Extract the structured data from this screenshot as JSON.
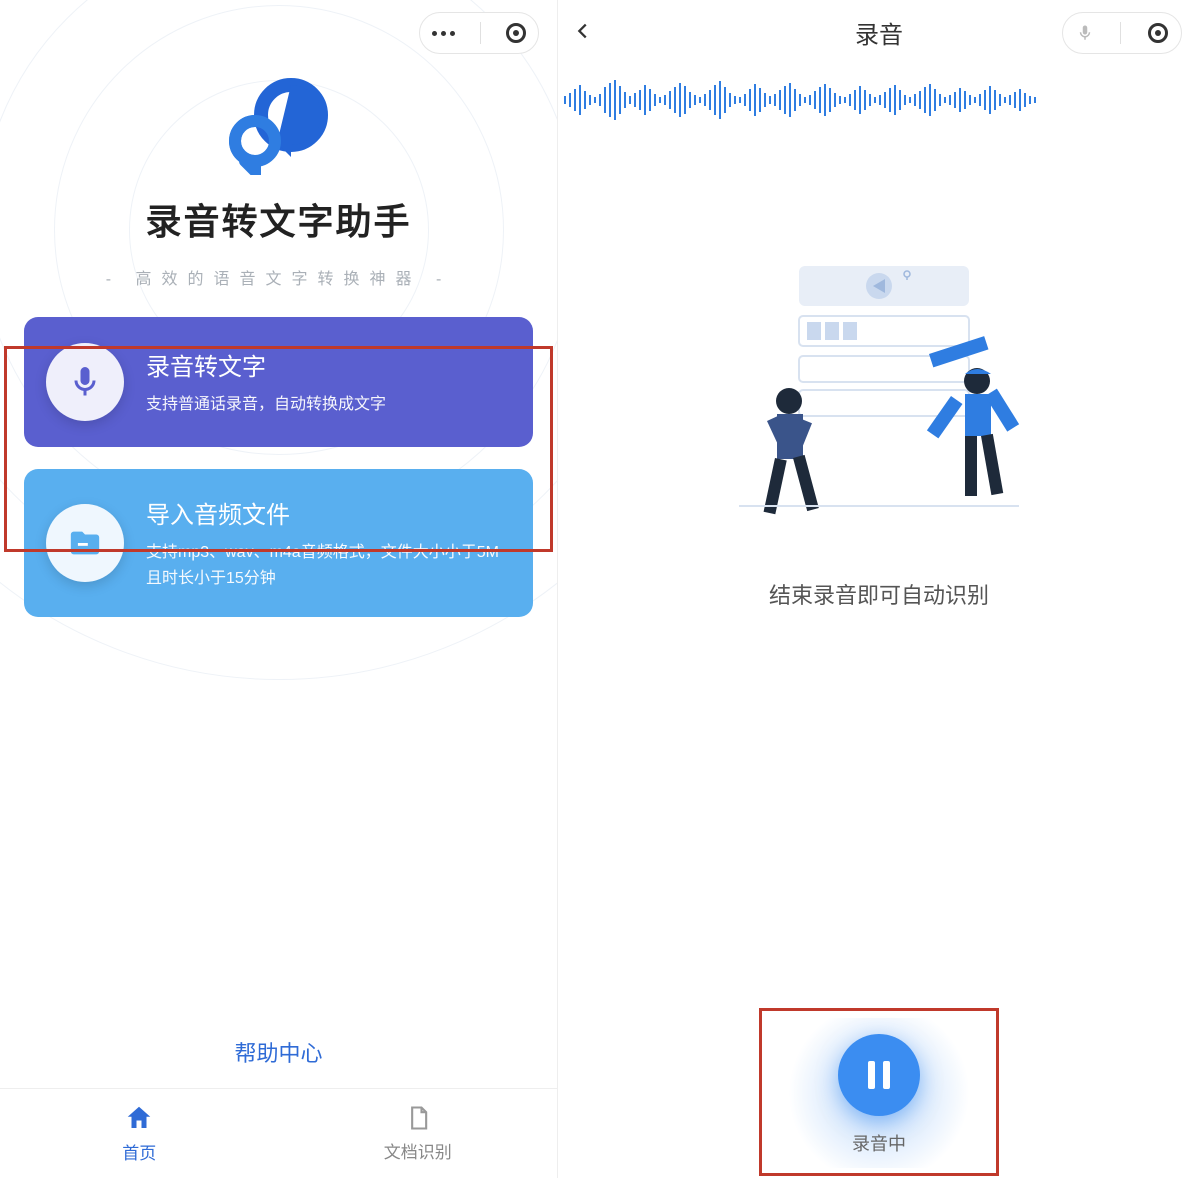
{
  "left": {
    "title": "录音转文字助手",
    "subtitle": "- 高效的语音文字转换神器 -",
    "cards": [
      {
        "title": "录音转文字",
        "desc": "支持普通话录音，自动转换成文字"
      },
      {
        "title": "导入音频文件",
        "desc": "支持mp3、wav、m4a音频格式，文件大小小于5M且时长小于15分钟"
      }
    ],
    "help_link": "帮助中心",
    "tabs": [
      {
        "label": "首页"
      },
      {
        "label": "文档识别"
      }
    ]
  },
  "right": {
    "nav_title": "录音",
    "caption": "结束录音即可自动识别",
    "record_label": "录音中"
  },
  "colors": {
    "accent_blue": "#2f6bd6",
    "card_primary": "#5a5fcf",
    "card_secondary": "#59afef",
    "highlight_red": "#c0392b"
  }
}
